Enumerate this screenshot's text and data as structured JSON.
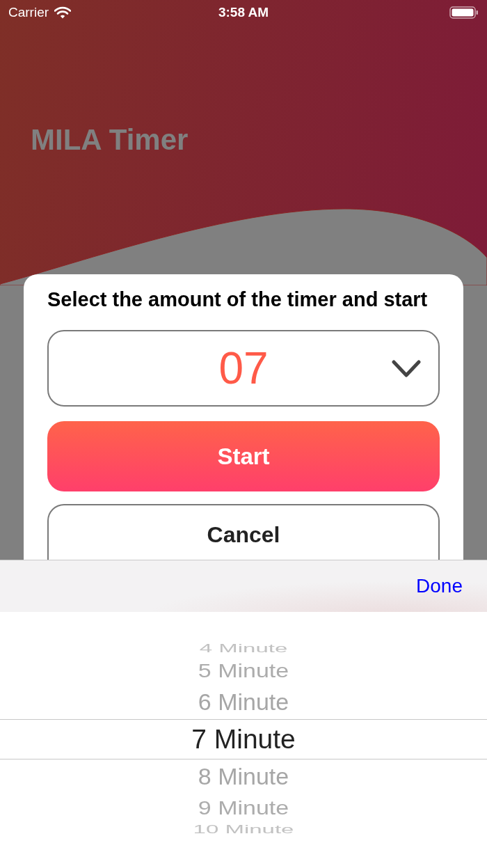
{
  "status_bar": {
    "carrier": "Carrier",
    "time": "3:58 AM"
  },
  "header": {
    "title": "MILA Timer"
  },
  "card": {
    "heading": "Select the amount of the timer and start",
    "dropdown": {
      "value": "07"
    },
    "buttons": [
      {
        "kind": "primary",
        "label": "Start"
      },
      {
        "kind": "secondary",
        "label": "Cancel"
      }
    ]
  },
  "picker_toolbar": {
    "done": "Done"
  },
  "picker": {
    "options": [
      {
        "label": "4 Minute",
        "selected": false
      },
      {
        "label": "5 Minute",
        "selected": false
      },
      {
        "label": "6 Minute",
        "selected": false
      },
      {
        "label": "7 Minute",
        "selected": true
      },
      {
        "label": "8 Minute",
        "selected": false
      },
      {
        "label": "9 Minute",
        "selected": false
      },
      {
        "label": "10 Minute",
        "selected": false
      }
    ]
  }
}
